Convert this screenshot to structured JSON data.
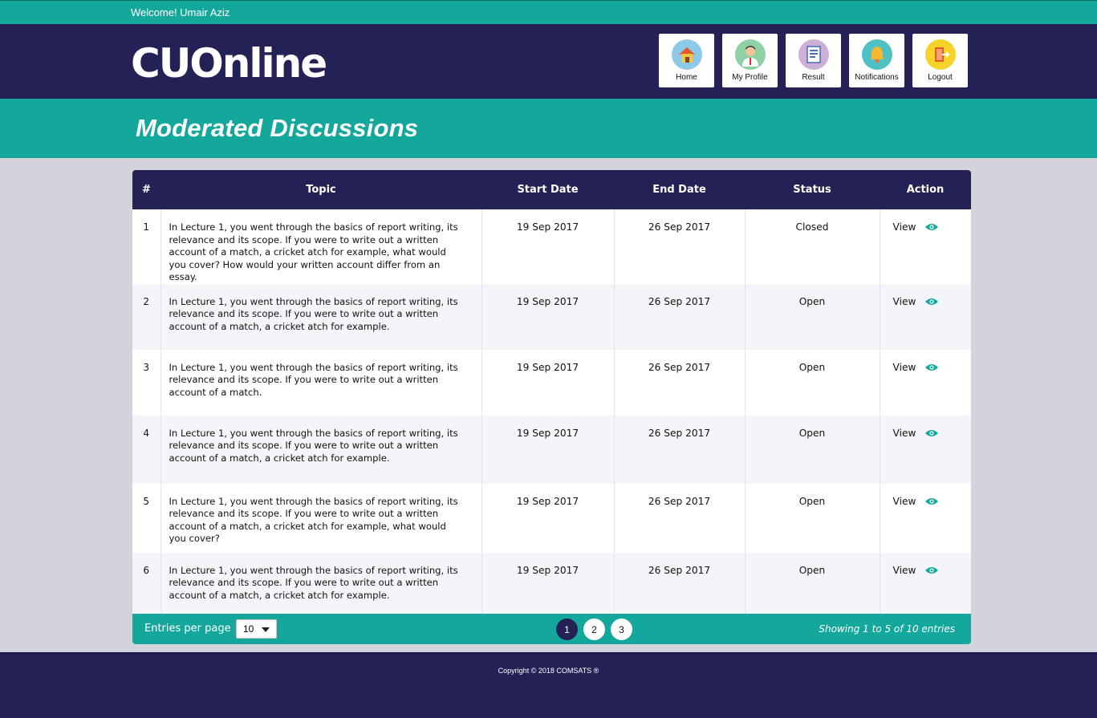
{
  "topbar": {
    "welcome": "Welcome! Umair Aziz"
  },
  "header": {
    "logo_text": "CUOnline",
    "nav": [
      {
        "label": "Home",
        "icon": "home-icon",
        "icon_bg": "#8ec9ea"
      },
      {
        "label": "My Profile",
        "icon": "profile-icon",
        "icon_bg": "#8fd1a4"
      },
      {
        "label": "Result",
        "icon": "result-icon",
        "icon_bg": "#cdb0d8"
      },
      {
        "label": "Notifications",
        "icon": "bell-icon",
        "icon_bg": "#4fc1c4"
      },
      {
        "label": "Logout",
        "icon": "logout-icon",
        "icon_bg": "#f6d32b"
      }
    ]
  },
  "page": {
    "title": "Moderated Discussions"
  },
  "table": {
    "columns": [
      "#",
      "Topic",
      "Start Date",
      "End Date",
      "Status",
      "Action"
    ],
    "rows": [
      {
        "num": "1",
        "topic": "In Lecture 1, you went through the basics of report writing, its relevance and its scope. If you were to write out a written account of a match, a cricket atch for example, what would you cover? How would your written account differ from an essay.",
        "start": "19 Sep 2017",
        "end": "26 Sep 2017",
        "status": "Closed",
        "action": "View"
      },
      {
        "num": "2",
        "topic": "In Lecture 1, you went through the basics of report writing, its relevance and its scope. If you were to write out a written account of a match, a cricket atch for example.",
        "start": "19 Sep 2017",
        "end": "26 Sep 2017",
        "status": "Open",
        "action": "View"
      },
      {
        "num": "3",
        "topic": "In Lecture 1, you went through the basics of report writing, its relevance and its scope. If you were to write out a written account of a match.",
        "start": "19 Sep 2017",
        "end": "26 Sep 2017",
        "status": "Open",
        "action": "View"
      },
      {
        "num": "4",
        "topic": "In Lecture 1, you went through the basics of report writing, its relevance and its scope. If you were to write out a written account of a match, a cricket atch for example.",
        "start": "19 Sep 2017",
        "end": "26 Sep 2017",
        "status": "Open",
        "action": "View"
      },
      {
        "num": "5",
        "topic": "In Lecture 1, you went through the basics of report writing, its relevance and its scope. If you were to write out a written account of a match, a cricket atch for example, what would you cover?",
        "start": "19 Sep 2017",
        "end": "26 Sep 2017",
        "status": "Open",
        "action": "View"
      },
      {
        "num": "6",
        "topic": "In Lecture 1, you went through the basics of report writing, its relevance and its scope. If you were to write out a written account of a match, a cricket atch for example.",
        "start": "19 Sep 2017",
        "end": "26 Sep 2017",
        "status": "Open",
        "action": "View"
      }
    ]
  },
  "pagination": {
    "entries_label": "Entries per page",
    "entries_value": "10",
    "pages": [
      "1",
      "2",
      "3"
    ],
    "active_page": "1",
    "showing": "Showing 1 to 5 of 10 entries"
  },
  "footer": {
    "copyright": "Copyright © 2018 COMSATS ®"
  },
  "colors": {
    "teal": "#14a79c",
    "navy": "#232155",
    "page_bg": "#d3d3dc"
  }
}
